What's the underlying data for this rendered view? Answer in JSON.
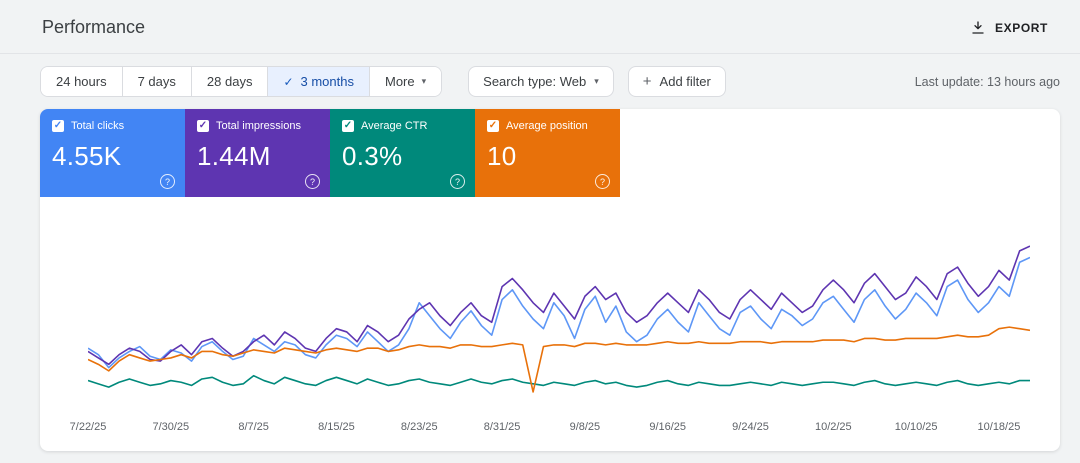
{
  "header": {
    "title": "Performance",
    "export_label": "EXPORT"
  },
  "icons": {
    "check": "✓",
    "caret": "▾",
    "plus": "+",
    "help": "?"
  },
  "filters": {
    "date_ranges": [
      {
        "label": "24 hours",
        "selected": false
      },
      {
        "label": "7 days",
        "selected": false
      },
      {
        "label": "28 days",
        "selected": false
      },
      {
        "label": "3 months",
        "selected": true
      },
      {
        "label": "More",
        "selected": false,
        "has_caret": true
      }
    ],
    "search_type_label": "Search type: Web",
    "add_filter_label": "Add filter",
    "last_update": "Last update: 13 hours ago"
  },
  "metrics": [
    {
      "label": "Total clicks",
      "value": "4.55K",
      "color": "#4285f4",
      "checked": true
    },
    {
      "label": "Total impressions",
      "value": "1.44M",
      "color": "#5e35b1",
      "checked": true
    },
    {
      "label": "Average CTR",
      "value": "0.3%",
      "color": "#00897b",
      "checked": true
    },
    {
      "label": "Average position",
      "value": "10",
      "color": "#e8710a",
      "checked": true
    }
  ],
  "chart_data": {
    "type": "line",
    "title": "Search performance over time (daily)",
    "x_tick_labels": [
      "7/22/25",
      "7/30/25",
      "8/7/25",
      "8/15/25",
      "8/23/25",
      "8/31/25",
      "9/8/25",
      "9/16/25",
      "9/24/25",
      "10/2/25",
      "10/10/25",
      "10/18/25"
    ],
    "x_tick_day_indices": [
      0,
      8,
      16,
      24,
      32,
      40,
      48,
      56,
      64,
      72,
      80,
      88
    ],
    "num_days": 92,
    "x_range_start": "7/22/25",
    "x_range_end": "10/21/25",
    "y_unit": "normalized percent of chart height (0 = bottom, 100 = top); each series independently scaled as in Search Console",
    "grid": false,
    "legend": "metric cards act as legend",
    "series": [
      {
        "name": "Total clicks",
        "color": "#5e97f6",
        "values": [
          32,
          28,
          20,
          26,
          30,
          33,
          27,
          25,
          31,
          29,
          24,
          33,
          36,
          30,
          25,
          27,
          38,
          34,
          30,
          36,
          34,
          28,
          26,
          34,
          40,
          38,
          33,
          42,
          36,
          30,
          34,
          44,
          60,
          52,
          44,
          38,
          48,
          55,
          46,
          40,
          62,
          68,
          58,
          50,
          44,
          60,
          52,
          38,
          56,
          64,
          48,
          58,
          42,
          36,
          40,
          50,
          56,
          48,
          42,
          60,
          52,
          44,
          40,
          54,
          58,
          50,
          44,
          56,
          52,
          46,
          50,
          60,
          64,
          56,
          48,
          62,
          68,
          58,
          50,
          56,
          66,
          60,
          52,
          70,
          74,
          62,
          54,
          60,
          70,
          64,
          85,
          88
        ]
      },
      {
        "name": "Total impressions",
        "color": "#5e35b1",
        "values": [
          30,
          26,
          22,
          28,
          32,
          30,
          25,
          24,
          30,
          34,
          28,
          36,
          38,
          32,
          27,
          30,
          36,
          40,
          34,
          42,
          38,
          32,
          30,
          38,
          44,
          42,
          36,
          46,
          42,
          36,
          40,
          50,
          56,
          60,
          52,
          46,
          54,
          60,
          52,
          48,
          70,
          75,
          68,
          60,
          54,
          66,
          58,
          50,
          64,
          70,
          62,
          66,
          54,
          48,
          52,
          60,
          66,
          60,
          54,
          68,
          62,
          54,
          50,
          62,
          68,
          62,
          56,
          66,
          60,
          54,
          58,
          68,
          74,
          68,
          60,
          72,
          78,
          70,
          62,
          66,
          76,
          70,
          62,
          78,
          82,
          72,
          64,
          70,
          80,
          74,
          92,
          95
        ]
      },
      {
        "name": "Average CTR",
        "color": "#00897b",
        "values": [
          12,
          10,
          8,
          11,
          13,
          11,
          9,
          10,
          12,
          11,
          9,
          13,
          14,
          11,
          9,
          10,
          15,
          12,
          10,
          14,
          12,
          10,
          9,
          12,
          14,
          12,
          10,
          13,
          11,
          9,
          10,
          12,
          13,
          11,
          10,
          9,
          11,
          13,
          11,
          10,
          12,
          13,
          11,
          10,
          9,
          11,
          10,
          9,
          11,
          12,
          10,
          11,
          9,
          8,
          9,
          11,
          12,
          10,
          9,
          11,
          10,
          9,
          9,
          10,
          11,
          10,
          9,
          11,
          10,
          9,
          10,
          11,
          11,
          10,
          9,
          11,
          12,
          10,
          9,
          10,
          11,
          10,
          9,
          11,
          12,
          10,
          9,
          10,
          11,
          10,
          12,
          12
        ]
      },
      {
        "name": "Average position",
        "color": "#e8710a",
        "values": [
          25,
          22,
          18,
          24,
          28,
          26,
          24,
          25,
          26,
          28,
          26,
          30,
          30,
          28,
          27,
          29,
          31,
          30,
          29,
          32,
          31,
          30,
          29,
          31,
          32,
          31,
          30,
          32,
          32,
          30,
          31,
          33,
          34,
          33,
          33,
          32,
          34,
          34,
          33,
          33,
          34,
          35,
          34,
          5,
          33,
          34,
          34,
          33,
          35,
          35,
          34,
          35,
          34,
          34,
          34,
          35,
          36,
          35,
          35,
          36,
          35,
          35,
          35,
          36,
          36,
          36,
          35,
          36,
          36,
          36,
          36,
          37,
          37,
          37,
          36,
          38,
          38,
          37,
          37,
          38,
          38,
          38,
          38,
          39,
          40,
          39,
          39,
          40,
          44,
          45,
          44,
          43
        ]
      }
    ]
  }
}
